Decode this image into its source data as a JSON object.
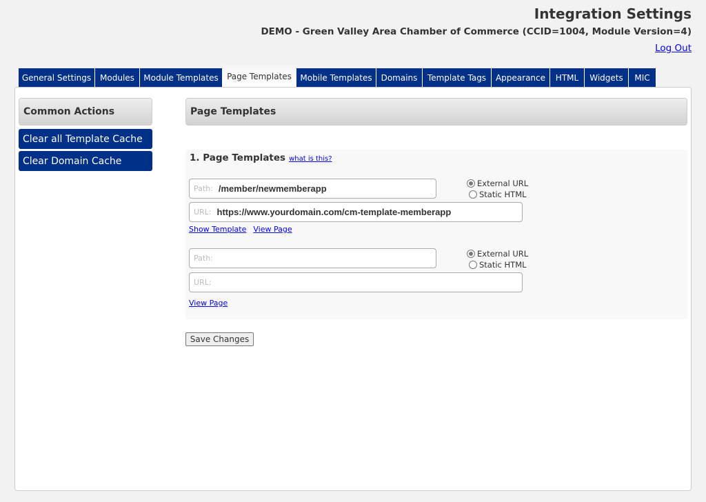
{
  "header": {
    "title": "Integration Settings",
    "subtitle": "DEMO - Green Valley Area Chamber of Commerce (CCID=1004, Module Version=4)",
    "logout": "Log Out"
  },
  "tabs": [
    "General Settings",
    "Modules",
    "Module Templates",
    "Page Templates",
    "Mobile Templates",
    "Domains",
    "Template Tags",
    "Appearance",
    "HTML",
    "Widgets",
    "MIC"
  ],
  "active_tab": "Page Templates",
  "sidebar": {
    "title": "Common Actions",
    "actions": [
      "Clear all Template Cache",
      "Clear Domain Cache"
    ]
  },
  "main": {
    "title": "Page Templates",
    "section_title": "1. Page Templates",
    "help_link": "what is this?",
    "entries": [
      {
        "path_label": "Path:",
        "path": "/member/newmemberapp",
        "url_label": "URL:",
        "url": "https://www.yourdomain.com/cm-template-memberapp",
        "options": [
          "External URL",
          "Static HTML"
        ],
        "selected": "External URL",
        "links": [
          "Show Template",
          "View Page"
        ]
      },
      {
        "path_label": "Path:",
        "path": "",
        "url_label": "URL:",
        "url": "",
        "options": [
          "External URL",
          "Static HTML"
        ],
        "selected": "External URL",
        "links": [
          "View Page"
        ]
      }
    ],
    "save": "Save Changes"
  },
  "colors": {
    "brand": "#003087"
  }
}
